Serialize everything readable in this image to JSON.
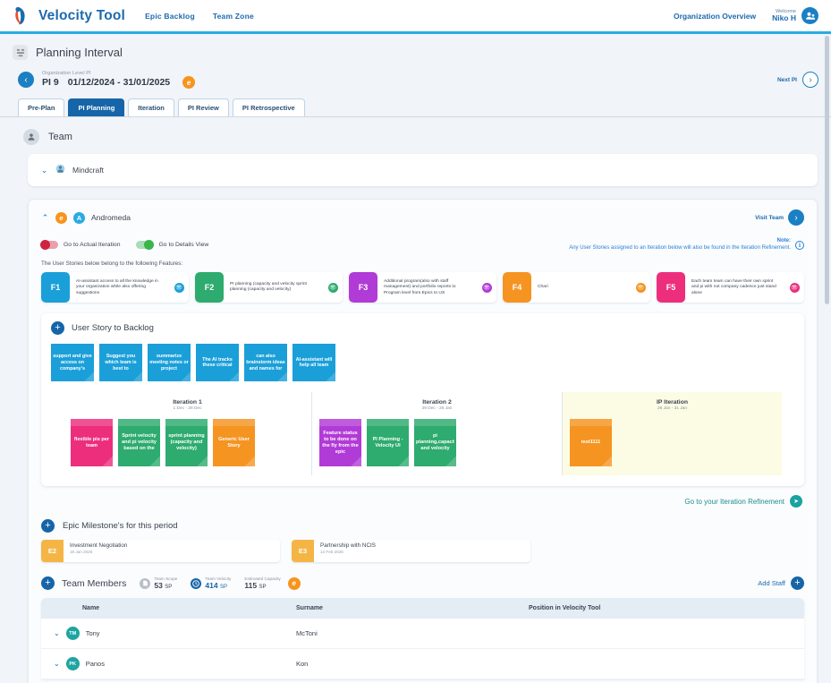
{
  "topbar": {
    "brand": "Velocity Tool",
    "nav": [
      {
        "label": "Epic Backlog"
      },
      {
        "label": "Team Zone"
      }
    ],
    "org_overview": "Organization Overview",
    "welcome_small": "Welcome",
    "welcome_user": "Niko H",
    "accent": "#29abe2"
  },
  "page": {
    "title": "Planning Interval",
    "pi_label": "Organization Level PI",
    "pi_number": "PI 9",
    "pi_dates": "01/12/2024 - 31/01/2025",
    "pi_badge": "e",
    "next_pi": "Next PI",
    "prev_arrow": "‹",
    "next_arrow": "›",
    "tabs": [
      {
        "label": "Pre-Plan",
        "active": false
      },
      {
        "label": "PI Planning",
        "active": true
      },
      {
        "label": "Iteration",
        "active": false
      },
      {
        "label": "PI Review",
        "active": false
      },
      {
        "label": "PI Retrospective",
        "active": false
      }
    ]
  },
  "team_section": {
    "heading": "Team",
    "collapsed_team": {
      "name": "Mindcraft",
      "chevron": "⌄"
    },
    "expanded_team": {
      "name": "Andromeda",
      "chevron": "⌃",
      "badge_orange": "e",
      "badge_blue": "A",
      "visit_team": "Visit Team"
    },
    "toggles": [
      {
        "label": "Go to Actual Iteration",
        "state": "off",
        "color": "#cf2440"
      },
      {
        "label": "Go to Details View",
        "state": "on",
        "color": "#39b54a"
      }
    ],
    "note": {
      "title": "Note:",
      "body": "Any User Stories assigned to an Iteration below will also be found in the Iteration Refinement.",
      "icon": "i"
    },
    "features_caption": "The User Stories below belong to the following Features:",
    "features": [
      {
        "key": "F1",
        "text": "AI-assistant access to all the knowledge in your organization while also offering suggestions",
        "color": "#1a9fd9"
      },
      {
        "key": "F2",
        "text": "PI planning (capacity and velocity sprint planning (capacity and velocity)",
        "color": "#2eab6e"
      },
      {
        "key": "F3",
        "text": "Additional program(also with staff management) and portfolio reports to Program level from Epics to US",
        "color": "#b13bd6"
      },
      {
        "key": "F4",
        "text": "Chari",
        "color": "#f59421"
      },
      {
        "key": "F5",
        "text": "Each team team can have their own sprint and pi with not company cadence just stand alone",
        "color": "#ec2e7d"
      }
    ]
  },
  "backlog": {
    "title": "User Story to Backlog",
    "plus": "+",
    "cards": [
      {
        "text": "support and give access on company's",
        "color": "#1a9fd9"
      },
      {
        "text": "Suggest you which team is best to",
        "color": "#1a9fd9"
      },
      {
        "text": "summarize meeting notes or project",
        "color": "#1a9fd9"
      },
      {
        "text": "The AI tracks these critical",
        "color": "#1a9fd9"
      },
      {
        "text": "can also brainstorm ideas and names for",
        "color": "#1a9fd9"
      },
      {
        "text": "AI-assistant will help all team",
        "color": "#1a9fd9"
      }
    ]
  },
  "iterations": [
    {
      "name": "Iteration 1",
      "dates": "1 Dec - 28 Dec",
      "cards": [
        {
          "text": "flexible pis per team",
          "color": "#ec2e7d"
        },
        {
          "text": "Sprint velocity and pi velocity based on the",
          "color": "#2eab6e"
        },
        {
          "text": "sprint planning (capacity and velocity)",
          "color": "#2eab6e"
        },
        {
          "text": "Generic User Story",
          "color": "#f59421"
        }
      ]
    },
    {
      "name": "Iteration 2",
      "dates": "29 Dec - 25 Jan",
      "cards": [
        {
          "text": "Feature status to be done on the fly from the epic",
          "color": "#b13bd6"
        },
        {
          "text": "PI Planning - Velocity UI",
          "color": "#2eab6e"
        },
        {
          "text": "pi planning,capacity and velocity",
          "color": "#2eab6e"
        }
      ]
    },
    {
      "name": "IP Iteration",
      "dates": "26 Jan - 31 Jan",
      "cards": [
        {
          "text": "test1111",
          "color": "#f59421"
        }
      ]
    }
  ],
  "refinement": {
    "label": "Go to your Iteration Refinement",
    "icon": "➤"
  },
  "milestones": {
    "title": "Epic Milestone's for this period",
    "plus": "+",
    "items": [
      {
        "key": "E2",
        "name": "Investment Negotiation",
        "date": "18 Jan 2025"
      },
      {
        "key": "E3",
        "name": "Partnership with NCIS",
        "date": "14 Feb 2025"
      }
    ]
  },
  "team_members": {
    "title": "Team Members",
    "plus": "+",
    "stats": [
      {
        "label": "Team Scope",
        "value": "53",
        "unit": "SP",
        "icon": "scope-icon",
        "tone": "grey"
      },
      {
        "label": "Team Velocity",
        "value": "414",
        "unit": "SP",
        "icon": "clock-icon",
        "tone": "blue"
      },
      {
        "label": "Estimated Capacity",
        "value": "115",
        "unit": "SP",
        "icon": "none",
        "tone": "plain"
      }
    ],
    "edit_badge": "e",
    "add_staff": "Add Staff",
    "add_staff_plus": "+",
    "columns": [
      "Name",
      "Surname",
      "Position in Velocity Tool"
    ],
    "rows": [
      {
        "initials": "TM",
        "name": "Tony",
        "surname": "McToni",
        "position": "",
        "chevron": "⌄"
      },
      {
        "initials": "PK",
        "name": "Panos",
        "surname": "Kon",
        "position": "",
        "chevron": "⌄"
      }
    ]
  }
}
